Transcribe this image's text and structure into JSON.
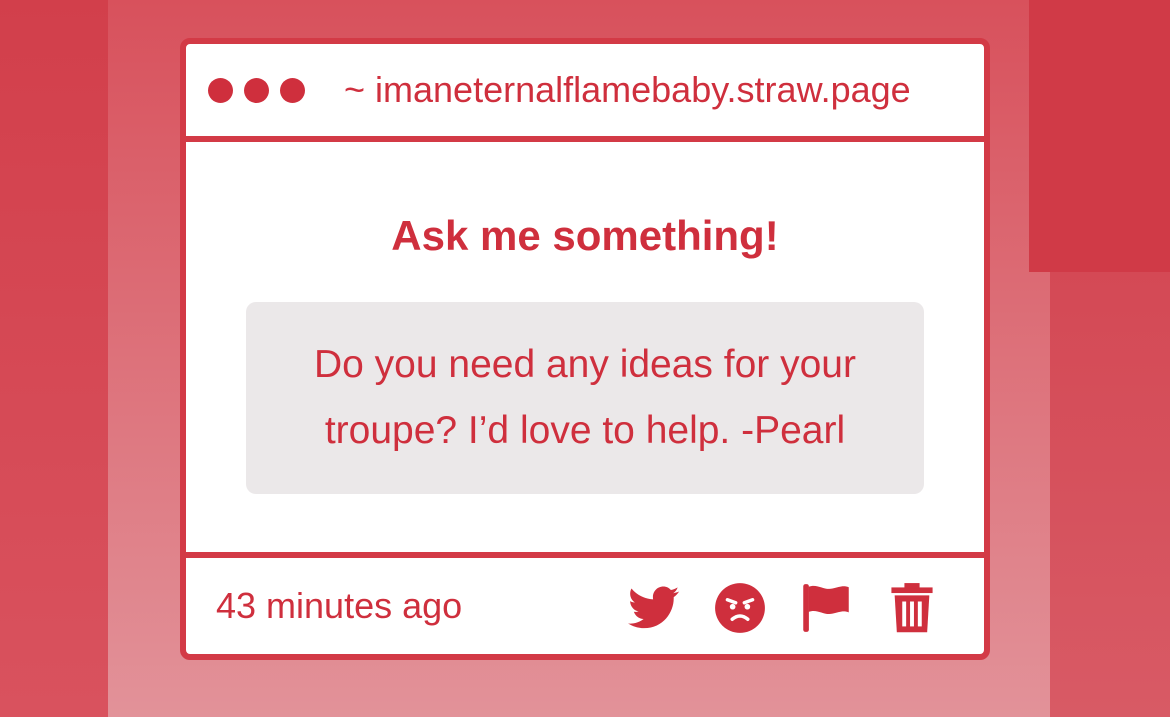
{
  "window": {
    "url": "~ imaneternalflamebaby.straw.page"
  },
  "content": {
    "title": "Ask me something!",
    "question_line1": "Do you need any ideas for your",
    "question_line2": "troupe? I’d love to help. -Pearl"
  },
  "footer": {
    "timestamp": "43 minutes ago",
    "actions": [
      {
        "icon": "twitter-icon"
      },
      {
        "icon": "angry-face-icon"
      },
      {
        "icon": "flag-icon"
      },
      {
        "icon": "trash-icon"
      }
    ]
  },
  "colors": {
    "accent": "#cf2f3d",
    "border": "#d33a46",
    "question_bg": "#ebe8e9",
    "background": "#d8515c"
  }
}
